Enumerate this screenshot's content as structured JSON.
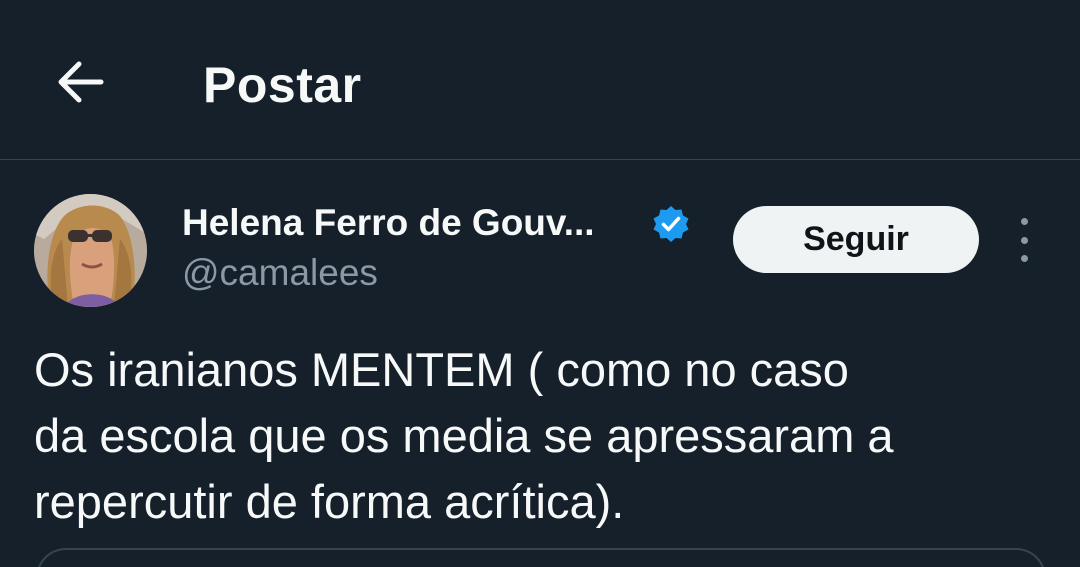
{
  "header": {
    "title": "Postar",
    "back_icon": "arrow-left-icon"
  },
  "post": {
    "author": {
      "display_name": "Helena Ferro de Gouv...",
      "handle": "@camalees",
      "verified_icon": "verified-badge-icon",
      "verified_color": "#1d9bf0"
    },
    "follow_label": "Seguir",
    "more_icon": "more-vertical-icon",
    "text_lines": [
      "Os iranianos MENTEM ( como no caso",
      "da escola que os media se apressaram a",
      "repercutir de forma acrítica)."
    ]
  },
  "theme": {
    "background": "#15202b",
    "text": "#f7f9f9",
    "secondary_text": "#8b98a5",
    "border": "#38444d"
  }
}
